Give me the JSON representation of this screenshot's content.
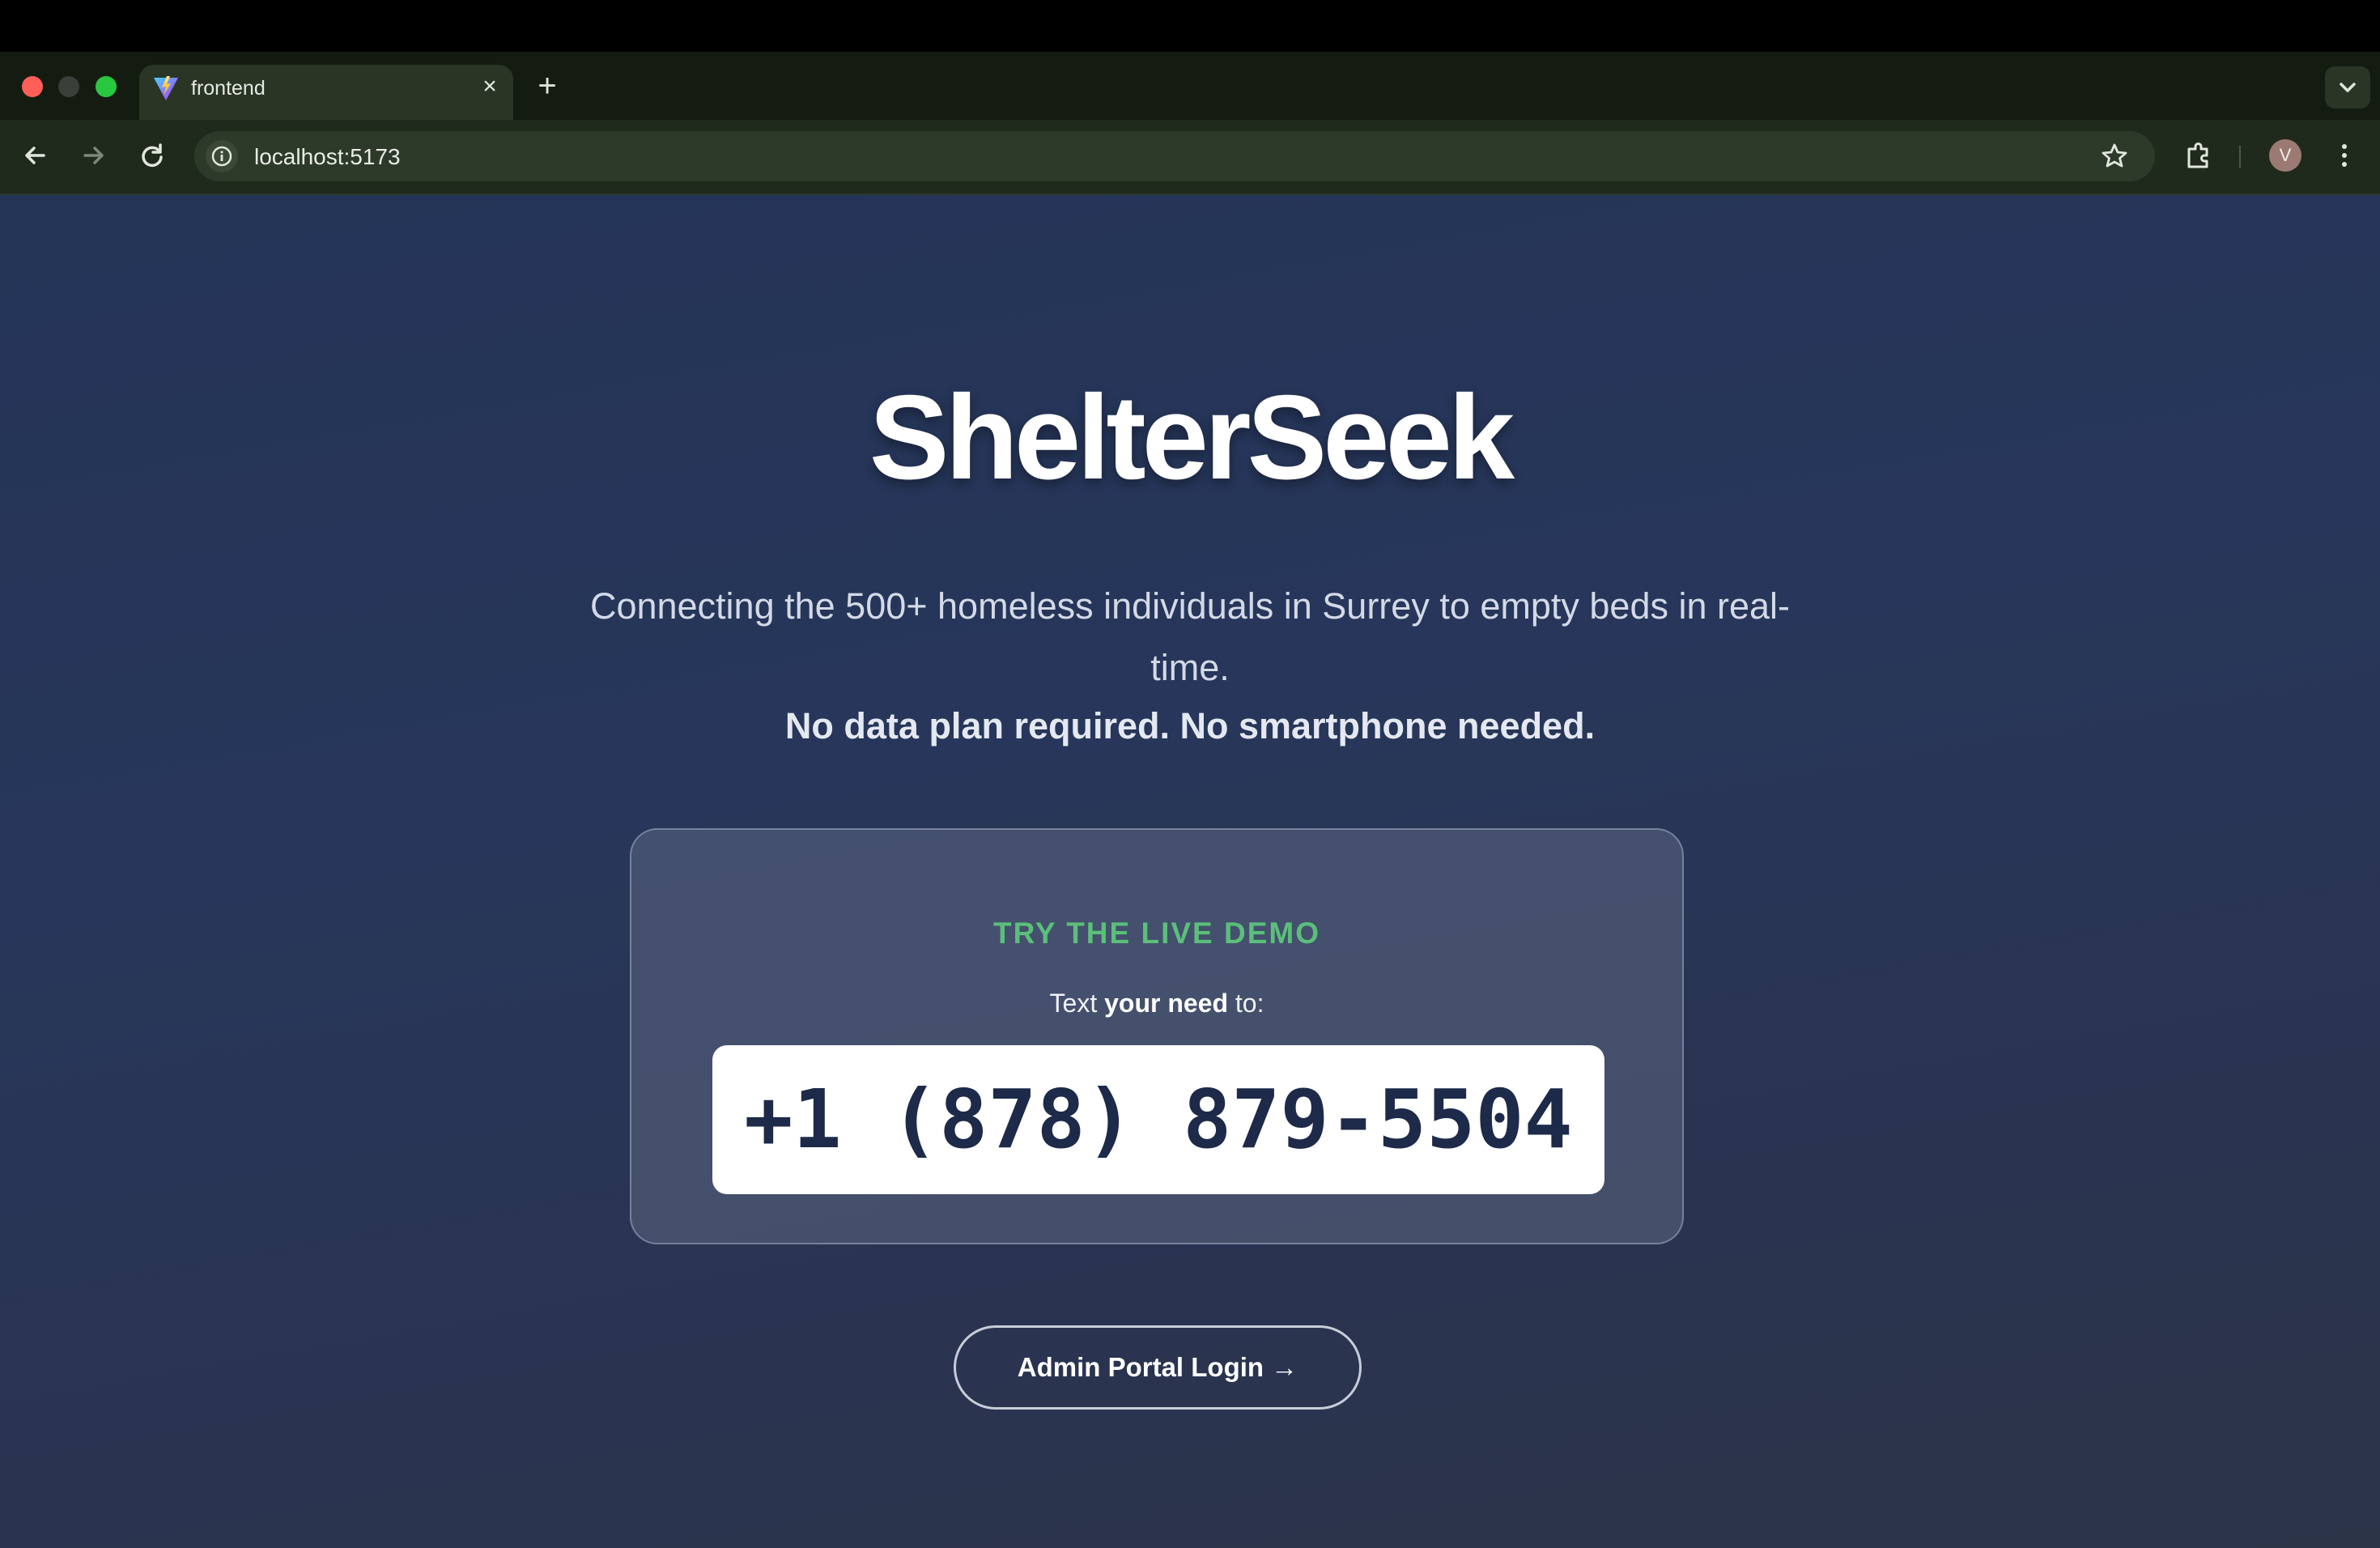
{
  "browser": {
    "tab": {
      "title": "frontend",
      "favicon": "vite-icon",
      "close_glyph": "×"
    },
    "new_tab_glyph": "+",
    "address_bar": {
      "url": "localhost:5173"
    },
    "profile_initial": "V"
  },
  "hero": {
    "brand": "ShelterSeek",
    "subtitle": "Connecting the 500+ homeless individuals in Surrey to empty beds in real-time.",
    "subtitle_strong": "No data plan required. No smartphone needed."
  },
  "demo": {
    "label": "TRY THE LIVE DEMO",
    "text_prefix": "Text ",
    "text_bold": "your need",
    "text_suffix": " to:",
    "phone_number": "+1 (878) 879-5504"
  },
  "admin": {
    "button_label": "Admin Portal Login →"
  },
  "colors": {
    "accent_green": "#5bbf7b",
    "page_bg": "#243457",
    "phone_text": "#1d2a49"
  }
}
